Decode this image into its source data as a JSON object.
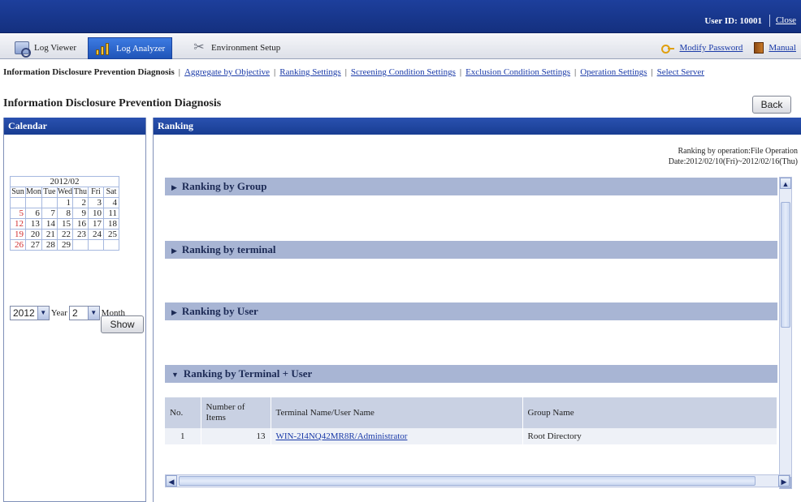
{
  "header": {
    "user_id": "User ID: 10001",
    "close": "Close"
  },
  "tabs": [
    {
      "label": "Log Viewer",
      "icon": "log-viewer-icon"
    },
    {
      "label": "Log Analyzer",
      "icon": "log-analyzer-icon"
    },
    {
      "label": "Environment Setup",
      "icon": "environment-setup-icon"
    }
  ],
  "top_links": {
    "modify_password": "Modify Password",
    "manual": "Manual"
  },
  "submenu": {
    "current": "Information Disclosure Prevention Diagnosis",
    "links": [
      "Aggregate by Objective",
      "Ranking Settings",
      "Screening Condition Settings",
      "Exclusion Condition Settings",
      "Operation Settings",
      "Select Server"
    ]
  },
  "page_title": "Information Disclosure Prevention Diagnosis",
  "back_button": "Back",
  "calendar": {
    "title": "Calendar",
    "year_month": "2012/02",
    "weekdays": [
      "Sun",
      "Mon",
      "Tue",
      "Wed",
      "Thu",
      "Fri",
      "Sat"
    ],
    "weeks": [
      [
        "",
        "",
        "",
        "1",
        "2",
        "3",
        "4"
      ],
      [
        "5",
        "6",
        "7",
        "8",
        "9",
        "10",
        "11"
      ],
      [
        "12",
        "13",
        "14",
        "15",
        "16",
        "17",
        "18"
      ],
      [
        "19",
        "20",
        "21",
        "22",
        "23",
        "24",
        "25"
      ],
      [
        "26",
        "27",
        "28",
        "29",
        "",
        "",
        ""
      ]
    ],
    "year_value": "2012",
    "year_label": "Year",
    "month_value": "2",
    "month_label": "Month",
    "show_button": "Show"
  },
  "ranking": {
    "title": "Ranking",
    "info_line1": "Ranking by operation:File Operation",
    "info_line2": "Date:2012/02/10(Fri)~2012/02/16(Thu)",
    "sections": [
      {
        "label": "Ranking by Group",
        "expanded": false
      },
      {
        "label": "Ranking by terminal",
        "expanded": false
      },
      {
        "label": "Ranking by User",
        "expanded": false
      },
      {
        "label": "Ranking by Terminal + User",
        "expanded": true
      }
    ],
    "table": {
      "headers": [
        "No.",
        "Number of Items",
        "Terminal Name/User Name",
        "Group Name"
      ],
      "rows": [
        [
          "1",
          "13",
          "WIN-2I4NQ42MR8R/Administrator",
          "Root Directory"
        ]
      ]
    }
  },
  "colors": {
    "header_blue": "#1d3f9c",
    "section_bar": "#a8b5d4",
    "holiday_red": "#d12c2c",
    "link_blue": "#1a3aa8"
  }
}
